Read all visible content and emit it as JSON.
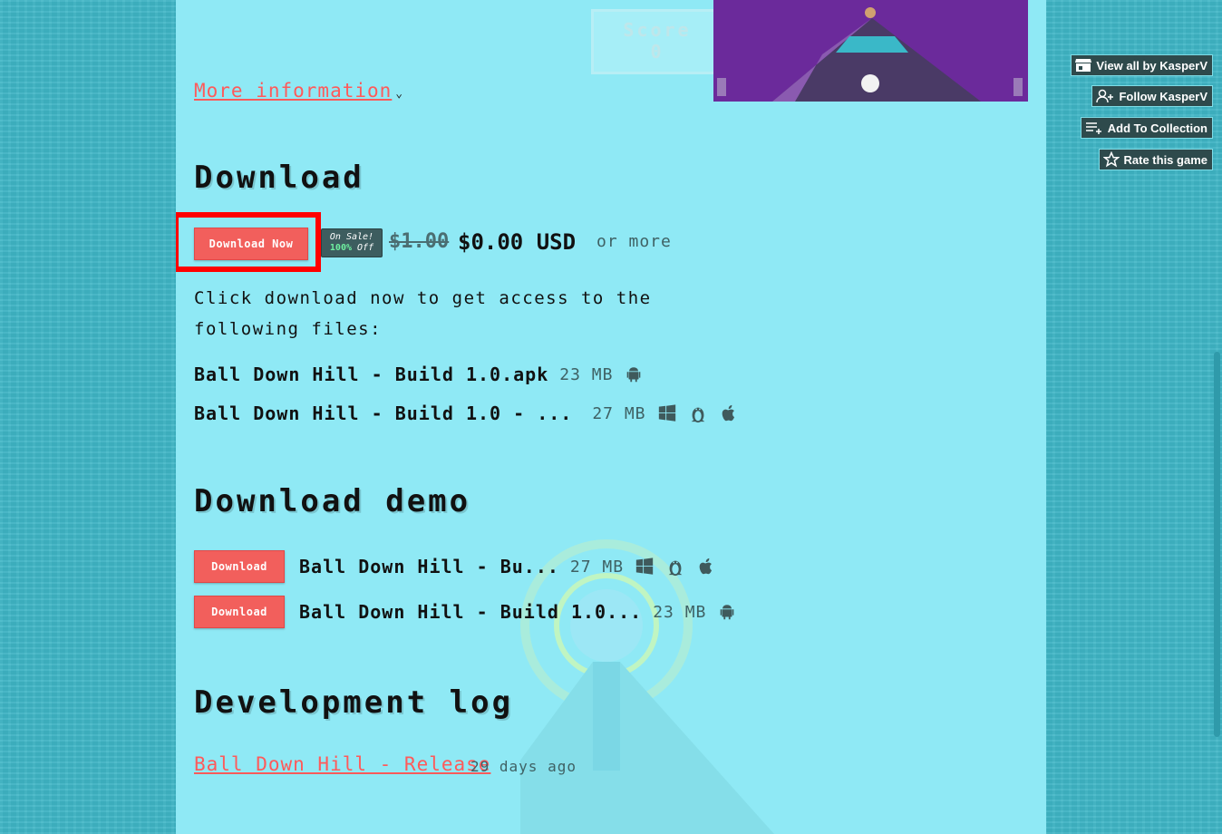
{
  "game_preview": {
    "score_label": "Score",
    "score_value": "0"
  },
  "more_info": {
    "label": "More information"
  },
  "download": {
    "heading": "Download",
    "button_label": "Download Now",
    "sale_badge": {
      "line1": "On Sale!",
      "percent": "100%",
      "off": "Off"
    },
    "original_price": "$1.00",
    "price": "$0.00 USD",
    "or_more": "or more",
    "description": "Click download now to get access to the following files:",
    "files": [
      {
        "name": "Ball Down Hill - Build 1.0.apk",
        "size": "23 MB",
        "platforms": [
          "android-icon"
        ]
      },
      {
        "name": "Ball Down Hill - Build 1.0 - ...",
        "size": "27 MB",
        "platforms": [
          "windows-icon",
          "linux-icon",
          "apple-icon"
        ]
      }
    ]
  },
  "demo": {
    "heading": "Download demo",
    "rows": [
      {
        "button": "Download",
        "name": "Ball Down Hill - Bu...",
        "size": "27 MB",
        "platforms": [
          "windows-icon",
          "linux-icon",
          "apple-icon"
        ]
      },
      {
        "button": "Download",
        "name": "Ball Down Hill - Build 1.0...",
        "size": "23 MB",
        "platforms": [
          "android-icon"
        ]
      }
    ]
  },
  "devlog": {
    "heading": "Development log",
    "entry_title": "Ball Down Hill - Release",
    "entry_time": "29 days ago"
  },
  "sidebar_actions": {
    "view_all": "View all by KasperV",
    "follow": "Follow KasperV",
    "add_collection": "Add To Collection",
    "rate": "Rate this game"
  },
  "colors": {
    "accent": "#f25f5c",
    "page_bg": "#8fe9f5",
    "outer_bg": "#3fb6c6",
    "highlight": "#ff0000"
  }
}
